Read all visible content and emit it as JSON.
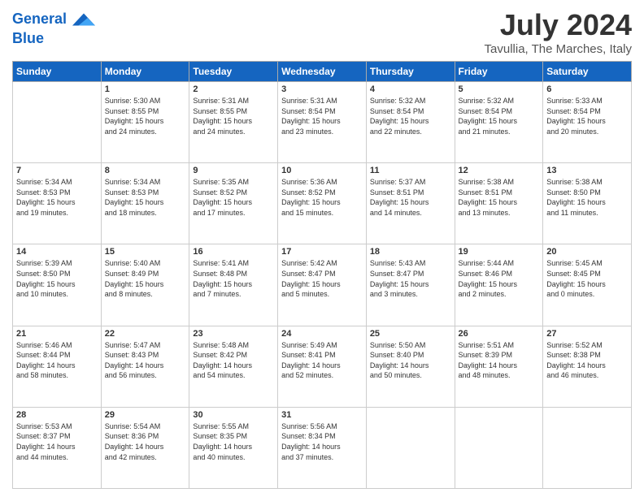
{
  "header": {
    "logo_line1": "General",
    "logo_line2": "Blue",
    "month": "July 2024",
    "location": "Tavullia, The Marches, Italy"
  },
  "days_of_week": [
    "Sunday",
    "Monday",
    "Tuesday",
    "Wednesday",
    "Thursday",
    "Friday",
    "Saturday"
  ],
  "weeks": [
    [
      {
        "num": "",
        "info": ""
      },
      {
        "num": "1",
        "info": "Sunrise: 5:30 AM\nSunset: 8:55 PM\nDaylight: 15 hours\nand 24 minutes."
      },
      {
        "num": "2",
        "info": "Sunrise: 5:31 AM\nSunset: 8:55 PM\nDaylight: 15 hours\nand 24 minutes."
      },
      {
        "num": "3",
        "info": "Sunrise: 5:31 AM\nSunset: 8:54 PM\nDaylight: 15 hours\nand 23 minutes."
      },
      {
        "num": "4",
        "info": "Sunrise: 5:32 AM\nSunset: 8:54 PM\nDaylight: 15 hours\nand 22 minutes."
      },
      {
        "num": "5",
        "info": "Sunrise: 5:32 AM\nSunset: 8:54 PM\nDaylight: 15 hours\nand 21 minutes."
      },
      {
        "num": "6",
        "info": "Sunrise: 5:33 AM\nSunset: 8:54 PM\nDaylight: 15 hours\nand 20 minutes."
      }
    ],
    [
      {
        "num": "7",
        "info": "Sunrise: 5:34 AM\nSunset: 8:53 PM\nDaylight: 15 hours\nand 19 minutes."
      },
      {
        "num": "8",
        "info": "Sunrise: 5:34 AM\nSunset: 8:53 PM\nDaylight: 15 hours\nand 18 minutes."
      },
      {
        "num": "9",
        "info": "Sunrise: 5:35 AM\nSunset: 8:52 PM\nDaylight: 15 hours\nand 17 minutes."
      },
      {
        "num": "10",
        "info": "Sunrise: 5:36 AM\nSunset: 8:52 PM\nDaylight: 15 hours\nand 15 minutes."
      },
      {
        "num": "11",
        "info": "Sunrise: 5:37 AM\nSunset: 8:51 PM\nDaylight: 15 hours\nand 14 minutes."
      },
      {
        "num": "12",
        "info": "Sunrise: 5:38 AM\nSunset: 8:51 PM\nDaylight: 15 hours\nand 13 minutes."
      },
      {
        "num": "13",
        "info": "Sunrise: 5:38 AM\nSunset: 8:50 PM\nDaylight: 15 hours\nand 11 minutes."
      }
    ],
    [
      {
        "num": "14",
        "info": "Sunrise: 5:39 AM\nSunset: 8:50 PM\nDaylight: 15 hours\nand 10 minutes."
      },
      {
        "num": "15",
        "info": "Sunrise: 5:40 AM\nSunset: 8:49 PM\nDaylight: 15 hours\nand 8 minutes."
      },
      {
        "num": "16",
        "info": "Sunrise: 5:41 AM\nSunset: 8:48 PM\nDaylight: 15 hours\nand 7 minutes."
      },
      {
        "num": "17",
        "info": "Sunrise: 5:42 AM\nSunset: 8:47 PM\nDaylight: 15 hours\nand 5 minutes."
      },
      {
        "num": "18",
        "info": "Sunrise: 5:43 AM\nSunset: 8:47 PM\nDaylight: 15 hours\nand 3 minutes."
      },
      {
        "num": "19",
        "info": "Sunrise: 5:44 AM\nSunset: 8:46 PM\nDaylight: 15 hours\nand 2 minutes."
      },
      {
        "num": "20",
        "info": "Sunrise: 5:45 AM\nSunset: 8:45 PM\nDaylight: 15 hours\nand 0 minutes."
      }
    ],
    [
      {
        "num": "21",
        "info": "Sunrise: 5:46 AM\nSunset: 8:44 PM\nDaylight: 14 hours\nand 58 minutes."
      },
      {
        "num": "22",
        "info": "Sunrise: 5:47 AM\nSunset: 8:43 PM\nDaylight: 14 hours\nand 56 minutes."
      },
      {
        "num": "23",
        "info": "Sunrise: 5:48 AM\nSunset: 8:42 PM\nDaylight: 14 hours\nand 54 minutes."
      },
      {
        "num": "24",
        "info": "Sunrise: 5:49 AM\nSunset: 8:41 PM\nDaylight: 14 hours\nand 52 minutes."
      },
      {
        "num": "25",
        "info": "Sunrise: 5:50 AM\nSunset: 8:40 PM\nDaylight: 14 hours\nand 50 minutes."
      },
      {
        "num": "26",
        "info": "Sunrise: 5:51 AM\nSunset: 8:39 PM\nDaylight: 14 hours\nand 48 minutes."
      },
      {
        "num": "27",
        "info": "Sunrise: 5:52 AM\nSunset: 8:38 PM\nDaylight: 14 hours\nand 46 minutes."
      }
    ],
    [
      {
        "num": "28",
        "info": "Sunrise: 5:53 AM\nSunset: 8:37 PM\nDaylight: 14 hours\nand 44 minutes."
      },
      {
        "num": "29",
        "info": "Sunrise: 5:54 AM\nSunset: 8:36 PM\nDaylight: 14 hours\nand 42 minutes."
      },
      {
        "num": "30",
        "info": "Sunrise: 5:55 AM\nSunset: 8:35 PM\nDaylight: 14 hours\nand 40 minutes."
      },
      {
        "num": "31",
        "info": "Sunrise: 5:56 AM\nSunset: 8:34 PM\nDaylight: 14 hours\nand 37 minutes."
      },
      {
        "num": "",
        "info": ""
      },
      {
        "num": "",
        "info": ""
      },
      {
        "num": "",
        "info": ""
      }
    ]
  ]
}
